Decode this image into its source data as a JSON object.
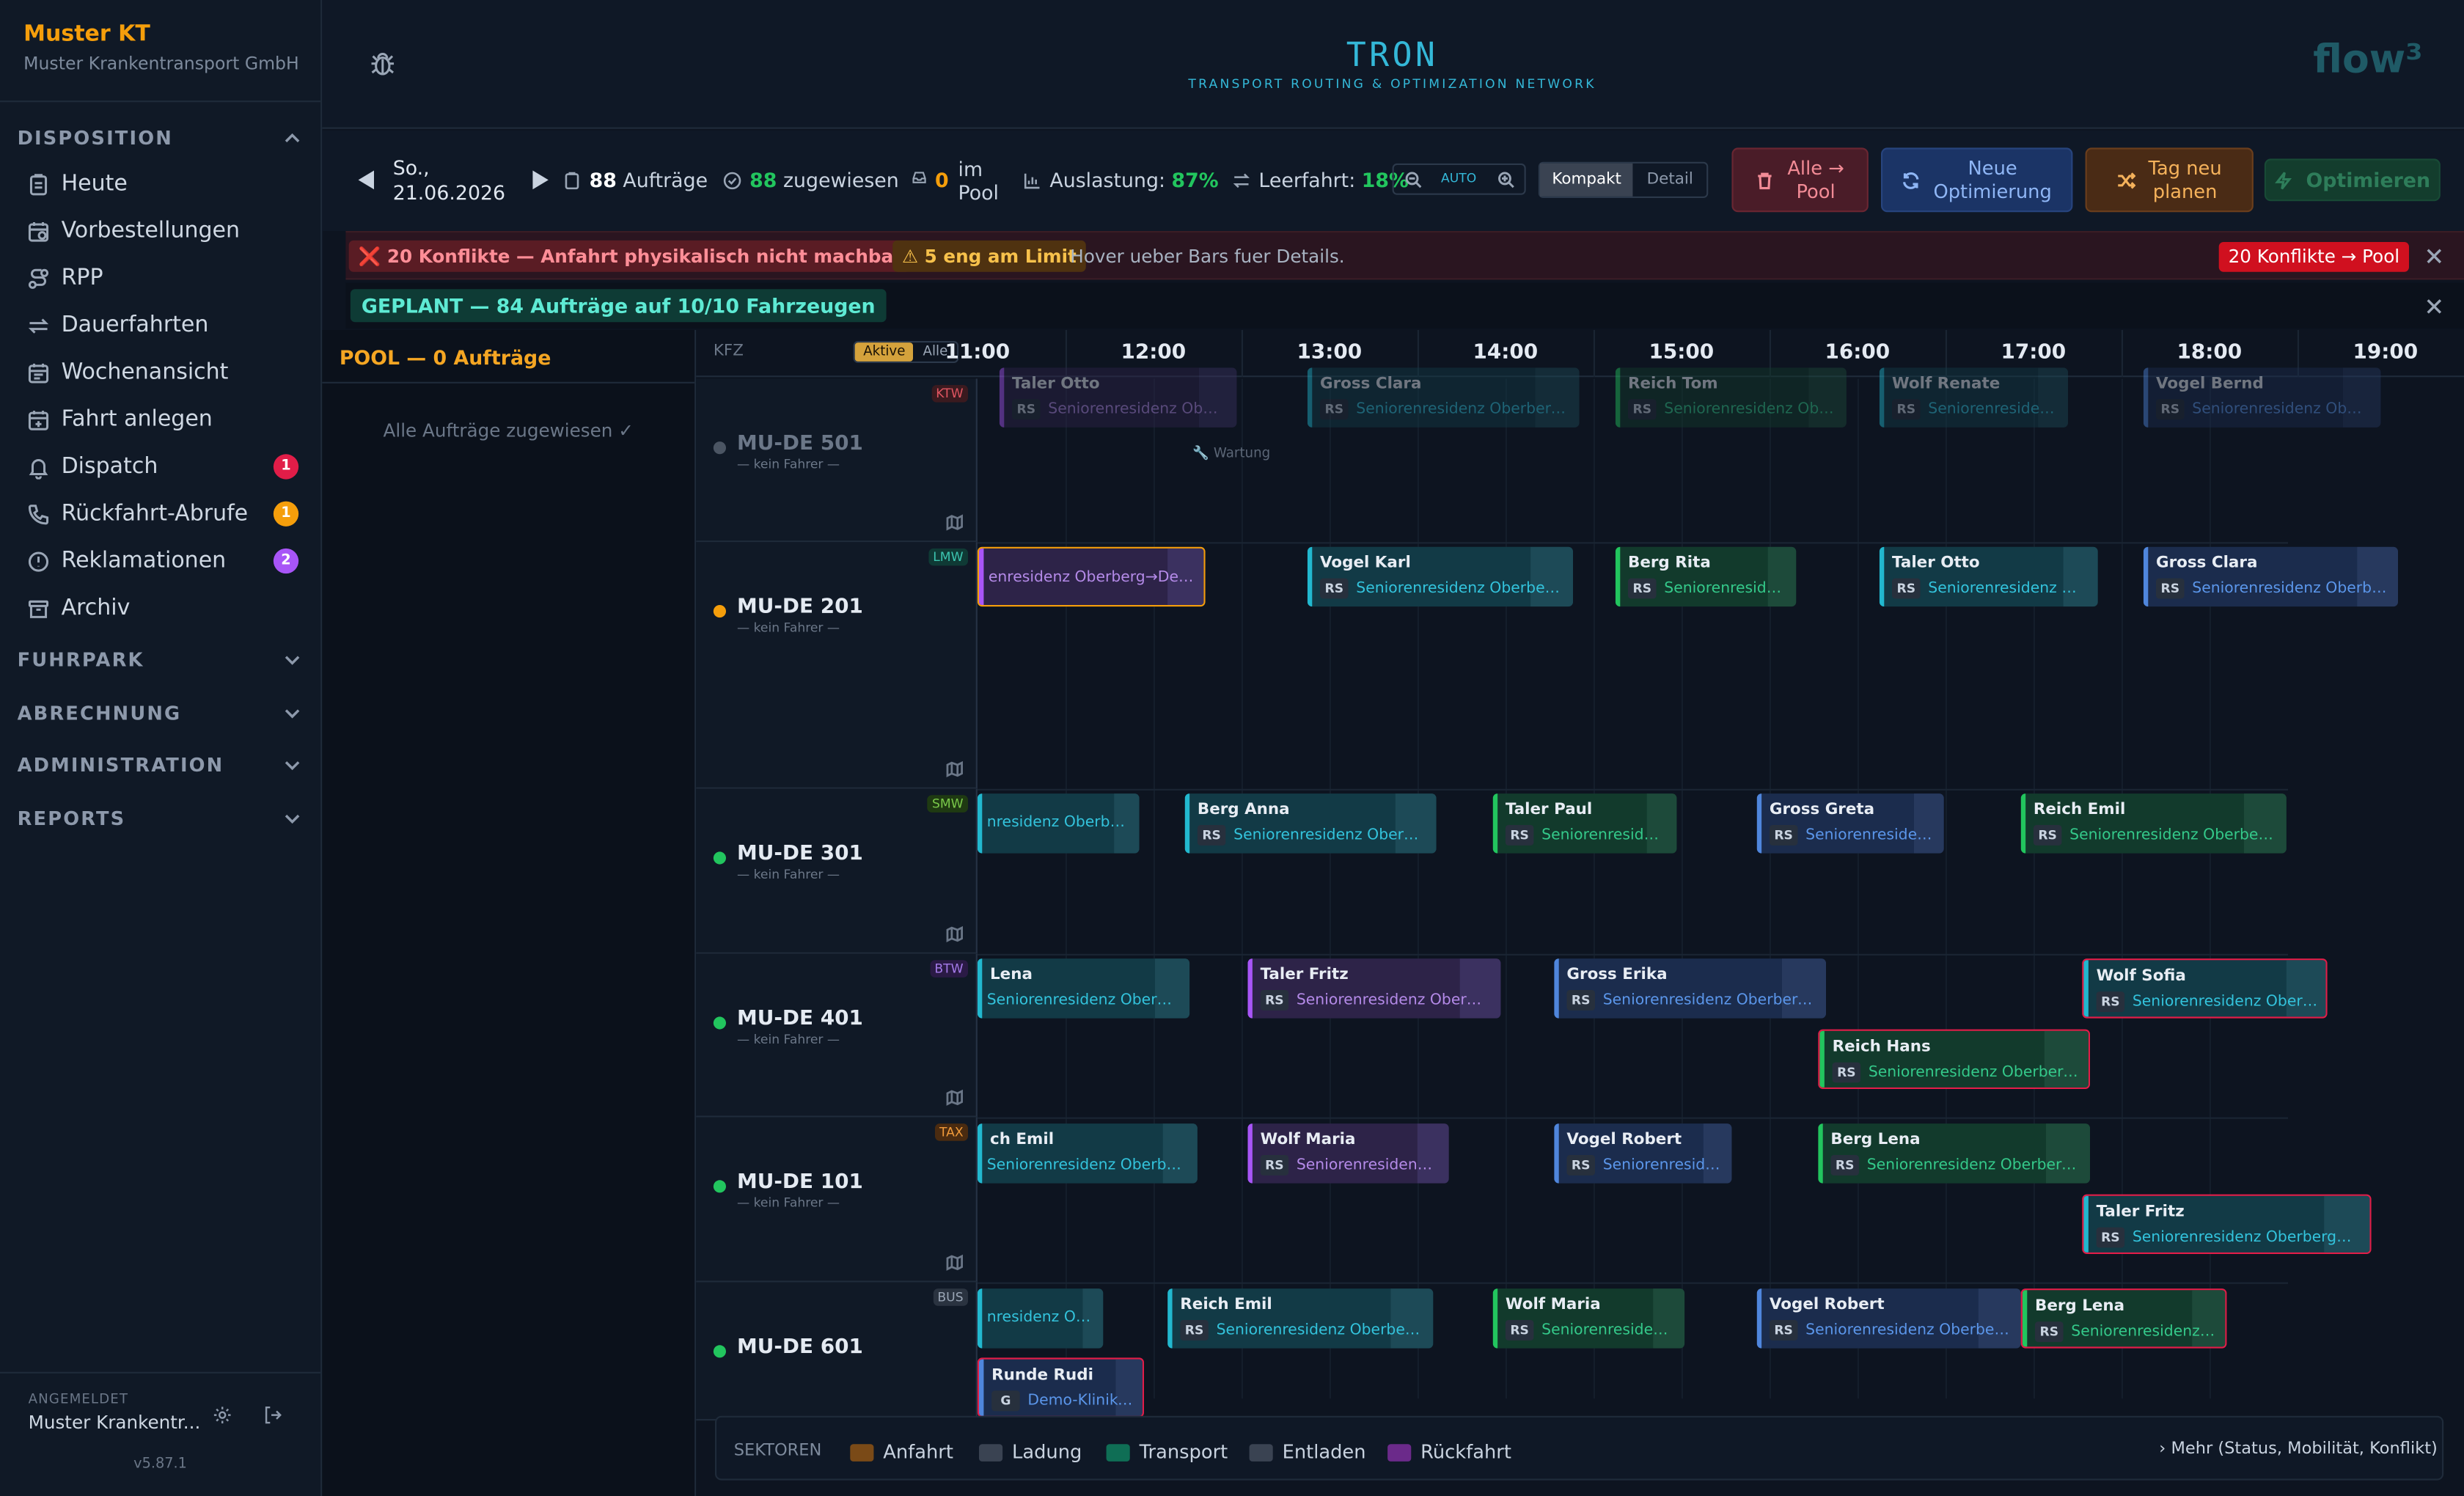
{
  "sidebar": {
    "org_name": "Muster KT",
    "org_subtitle": "Muster Krankentransport GmbH",
    "sections": {
      "disposition": "DISPOSITION",
      "fuhrpark": "FUHRPARK",
      "abrechnung": "ABRECHNUNG",
      "administration": "ADMINISTRATION",
      "reports": "REPORTS"
    },
    "items": [
      {
        "label": "Heute",
        "icon": "clipboard-icon"
      },
      {
        "label": "Vorbestellungen",
        "icon": "calendar-clock-icon"
      },
      {
        "label": "RPP",
        "icon": "route-icon"
      },
      {
        "label": "Dauerfahrten",
        "icon": "repeat-icon"
      },
      {
        "label": "Wochenansicht",
        "icon": "calendar-icon"
      },
      {
        "label": "Fahrt anlegen",
        "icon": "calendar-plus-icon"
      },
      {
        "label": "Dispatch",
        "icon": "bell-icon",
        "badge": "1",
        "badge_color": "#e11d48"
      },
      {
        "label": "Rückfahrt-Abrufe",
        "icon": "phone-icon",
        "badge": "1",
        "badge_color": "#f59e0b"
      },
      {
        "label": "Reklamationen",
        "icon": "alert-circle-icon",
        "badge": "2",
        "badge_color": "#a855f7"
      },
      {
        "label": "Archiv",
        "icon": "archive-icon"
      }
    ],
    "footer": {
      "logged_in_label": "ANGEMELDET",
      "user": "Muster Krankentr...",
      "version": "v5.87.1"
    }
  },
  "header": {
    "logo": "TRON",
    "logo_subtitle": "TRANSPORT ROUTING & OPTIMIZATION NETWORK",
    "brand": "flow³"
  },
  "toolbar": {
    "date_line1": "So.,",
    "date_line2": "21.06.2026",
    "orders_count": "88",
    "orders_label": "Aufträge",
    "assigned_count": "88",
    "assigned_label": "zugewiesen",
    "pool_count": "0",
    "pool_label1": "im",
    "pool_label2": "Pool",
    "util_label": "Auslastung:",
    "util_value": "87%",
    "empty_label": "Leerfahrt:",
    "empty_value": "18%",
    "zoom_label": "AUTO",
    "view_compact": "Kompakt",
    "view_detail": "Detail",
    "btn_all_pool_1": "Alle →",
    "btn_all_pool_2": "Pool",
    "btn_new_opt_1": "Neue",
    "btn_new_opt_2": "Optimierung",
    "btn_replan_1": "Tag neu",
    "btn_replan_2": "planen",
    "btn_optimize": "Optimieren"
  },
  "alert": {
    "conflicts": "❌ 20 Konflikte — Anfahrt physikalisch nicht machbar",
    "tight": "⚠ 5 eng am Limit",
    "hint": "Hover ueber Bars fuer Details.",
    "action": "20 Konflikte → Pool"
  },
  "planned_banner": "GEPLANT — 84 Aufträge auf 10/10 Fahrzeugen",
  "pool": {
    "title": "POOL — 0 Aufträge",
    "empty": "Alle Aufträge zugewiesen ✓"
  },
  "gantt": {
    "kfz_label": "KFZ",
    "filter_active": "Aktive",
    "filter_all": "Alle",
    "hours": [
      "11:00",
      "12:00",
      "13:00",
      "14:00",
      "15:00",
      "16:00",
      "17:00",
      "18:00",
      "19:00"
    ],
    "rows": [
      {
        "vehicle": "MU-DE 501",
        "driver": "— kein Fahrer —",
        "type": "KTW",
        "status_color": "#4b5563",
        "dim": true,
        "maintenance": "🔧 Wartung",
        "bars": [
          {
            "name": "Taler Otto",
            "code": "RS",
            "addr": "Seniorenresidenz Oberberg→...",
            "color": "purple"
          },
          {
            "name": "Gross Clara",
            "code": "RS",
            "addr": "Seniorenresidenz Oberberg→O...",
            "color": "teal"
          },
          {
            "name": "Reich Tom",
            "code": "RS",
            "addr": "Seniorenresidenz Oberb...",
            "color": "green"
          },
          {
            "name": "Wolf Renate",
            "code": "RS",
            "addr": "Seniorenresidenz ...",
            "color": "teal"
          },
          {
            "name": "Vogel Bernd",
            "code": "RS",
            "addr": "Seniorenresidenz Oberbe...",
            "color": "blue"
          }
        ]
      },
      {
        "vehicle": "MU-DE 201",
        "driver": "— kein Fahrer —",
        "type": "LMW",
        "status_color": "#f59e0b",
        "bars": [
          {
            "name": "",
            "code": "",
            "addr": "enresidenz Oberberg→Demo-...",
            "color": "purple",
            "outline": "orange"
          },
          {
            "name": "Vogel Karl",
            "code": "RS",
            "addr": "Seniorenresidenz Oberberg→...",
            "color": "teal"
          },
          {
            "name": "Berg Rita",
            "code": "RS",
            "addr": "Seniorenresiden...",
            "color": "green"
          },
          {
            "name": "Taler Otto",
            "code": "RS",
            "addr": "Seniorenresidenz Obe...",
            "color": "teal"
          },
          {
            "name": "Gross Clara",
            "code": "RS",
            "addr": "Seniorenresidenz Oberberg...",
            "color": "blue"
          }
        ]
      },
      {
        "vehicle": "MU-DE 301",
        "driver": "— kein Fahrer —",
        "type": "SMW",
        "status_color": "#22c55e",
        "bars": [
          {
            "name": "",
            "code": "",
            "addr": "nresidenz Oberberg→...",
            "color": "teal"
          },
          {
            "name": "Berg Anna",
            "code": "RS",
            "addr": "Seniorenresidenz Oberberg...",
            "color": "teal"
          },
          {
            "name": "Taler Paul",
            "code": "RS",
            "addr": "Seniorenresidenz...",
            "color": "green"
          },
          {
            "name": "Gross Greta",
            "code": "RS",
            "addr": "Seniorenresidenz...",
            "color": "blue"
          },
          {
            "name": "Reich Emil",
            "code": "RS",
            "addr": "Seniorenresidenz Oberberg→...",
            "color": "green"
          }
        ]
      },
      {
        "vehicle": "MU-DE 401",
        "driver": "— kein Fahrer —",
        "type": "BTW",
        "status_color": "#22c55e",
        "bars": [
          {
            "name": "Lena",
            "code": "",
            "addr": "Seniorenresidenz Oberberg...",
            "color": "teal"
          },
          {
            "name": "Taler Fritz",
            "code": "RS",
            "addr": "Seniorenresidenz Oberberg...",
            "color": "purple"
          },
          {
            "name": "Gross Erika",
            "code": "RS",
            "addr": "Seniorenresidenz Oberberg→D...",
            "color": "blue"
          },
          {
            "name": "Wolf Sofia",
            "code": "RS",
            "addr": "Seniorenresidenz Oberber...",
            "color": "teal",
            "outline": "red"
          },
          {
            "name": "Reich Hans",
            "code": "RS",
            "addr": "Seniorenresidenz Oberberg→...",
            "color": "green",
            "outline": "red"
          }
        ]
      },
      {
        "vehicle": "MU-DE 101",
        "driver": "— kein Fahrer —",
        "type": "TAX",
        "status_color": "#22c55e",
        "bars": [
          {
            "name": "ch Emil",
            "code": "",
            "addr": "Seniorenresidenz Oberberg...",
            "color": "teal"
          },
          {
            "name": "Wolf Maria",
            "code": "RS",
            "addr": "Seniorenresidenz O...",
            "color": "purple"
          },
          {
            "name": "Vogel Robert",
            "code": "RS",
            "addr": "Seniorenresiden...",
            "color": "blue"
          },
          {
            "name": "Berg Lena",
            "code": "RS",
            "addr": "Seniorenresidenz Oberberg→D...",
            "color": "green"
          },
          {
            "name": "Taler Fritz",
            "code": "RS",
            "addr": "Seniorenresidenz Oberberg→De...",
            "color": "teal",
            "outline": "red"
          }
        ]
      },
      {
        "vehicle": "MU-DE 601",
        "driver": "",
        "type": "BUS",
        "status_color": "#22c55e",
        "bars": [
          {
            "name": "",
            "code": "",
            "addr": "nresidenz Ober...",
            "color": "teal"
          },
          {
            "name": "Reich Emil",
            "code": "RS",
            "addr": "Seniorenresidenz Oberberg→...",
            "color": "teal"
          },
          {
            "name": "Wolf Maria",
            "code": "RS",
            "addr": "Seniorenresidenz ...",
            "color": "green"
          },
          {
            "name": "Vogel Robert",
            "code": "RS",
            "addr": "Seniorenresidenz Oberberg→...",
            "color": "blue"
          },
          {
            "name": "Berg Lena",
            "code": "RS",
            "addr": "Seniorenresidenz O...",
            "color": "green",
            "outline": "red"
          },
          {
            "name": "Runde Rudi",
            "code": "G",
            "addr": "Demo-Klinikum ...",
            "color": "blue",
            "outline": "red"
          }
        ]
      }
    ]
  },
  "legend": {
    "title": "SEKTOREN",
    "items": [
      {
        "label": "Anfahrt",
        "color": "#7a4a17"
      },
      {
        "label": "Ladung",
        "color": "#3a4352"
      },
      {
        "label": "Transport",
        "color": "#0f6e55"
      },
      {
        "label": "Entladen",
        "color": "#3a4352"
      },
      {
        "label": "Rückfahrt",
        "color": "#6b2a8a"
      }
    ],
    "more": "Mehr (Status, Mobilität, Konflikt)"
  }
}
